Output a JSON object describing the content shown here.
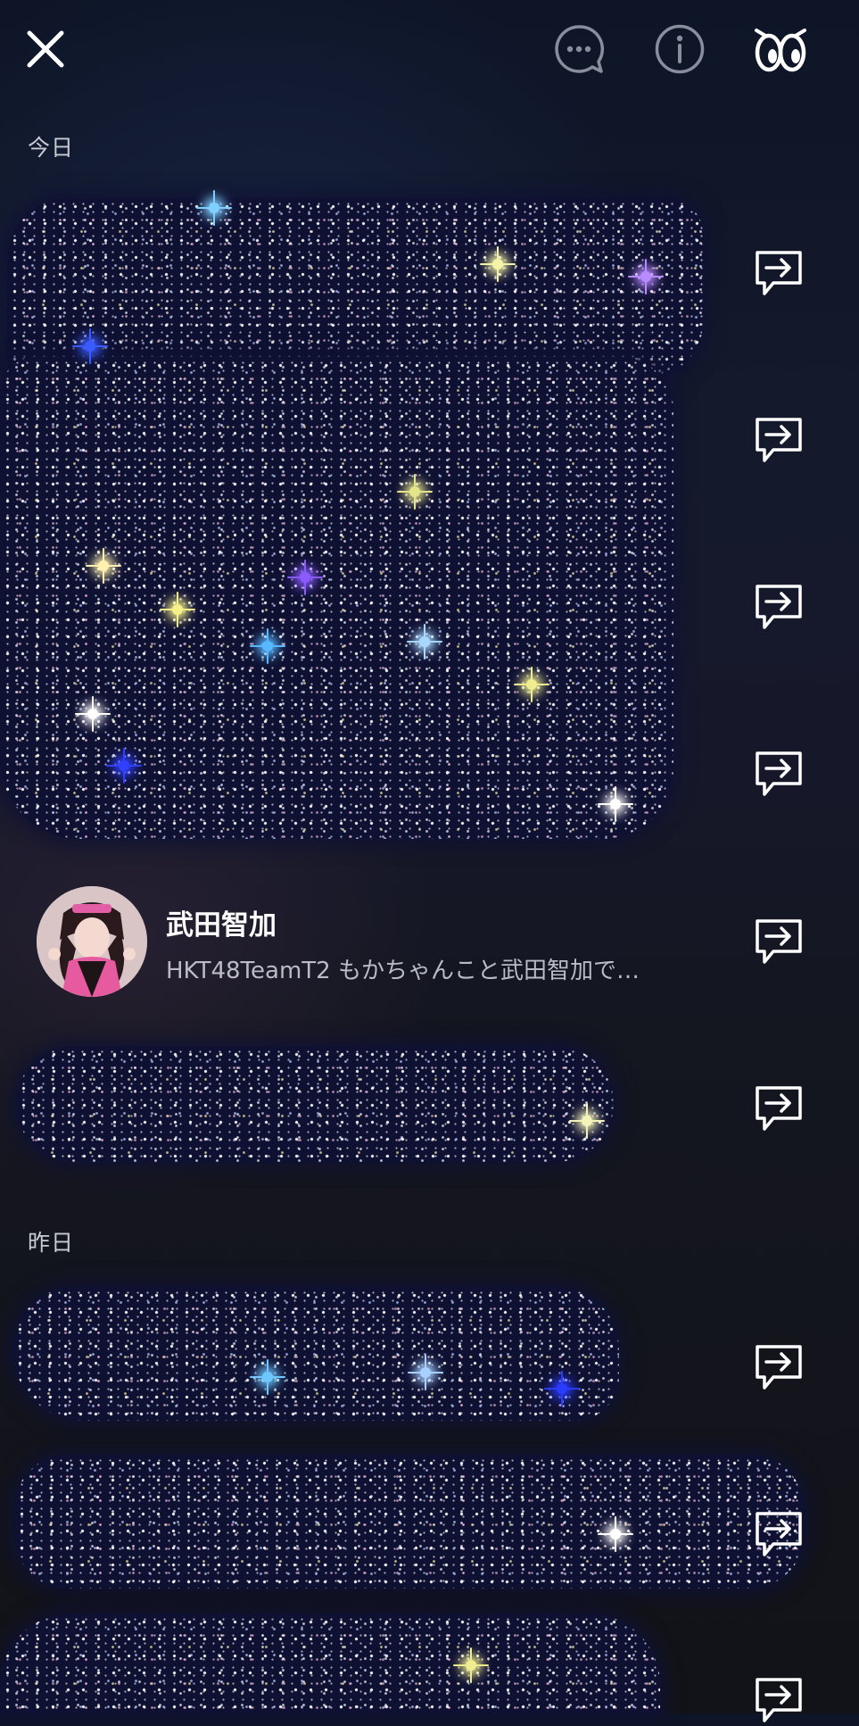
{
  "header": {
    "close_icon": "close-icon",
    "chat_icon": "chat-bubble-icon",
    "info_icon": "info-icon",
    "eyes_icon": "eyes-icon"
  },
  "sections": {
    "today_label": "今日",
    "yesterday_label": "昨日"
  },
  "chat_item": {
    "name": "武田智加",
    "preview": "HKT48TeamT2 もかちゃんこと武田智加で…"
  },
  "share_icon": "share-forward-icon",
  "colors": {
    "background": "#141620",
    "glitter_base": "#0f1133",
    "text_primary": "#ffffff",
    "text_secondary": "#b9bcc6",
    "section_label": "#c9cbd3"
  }
}
